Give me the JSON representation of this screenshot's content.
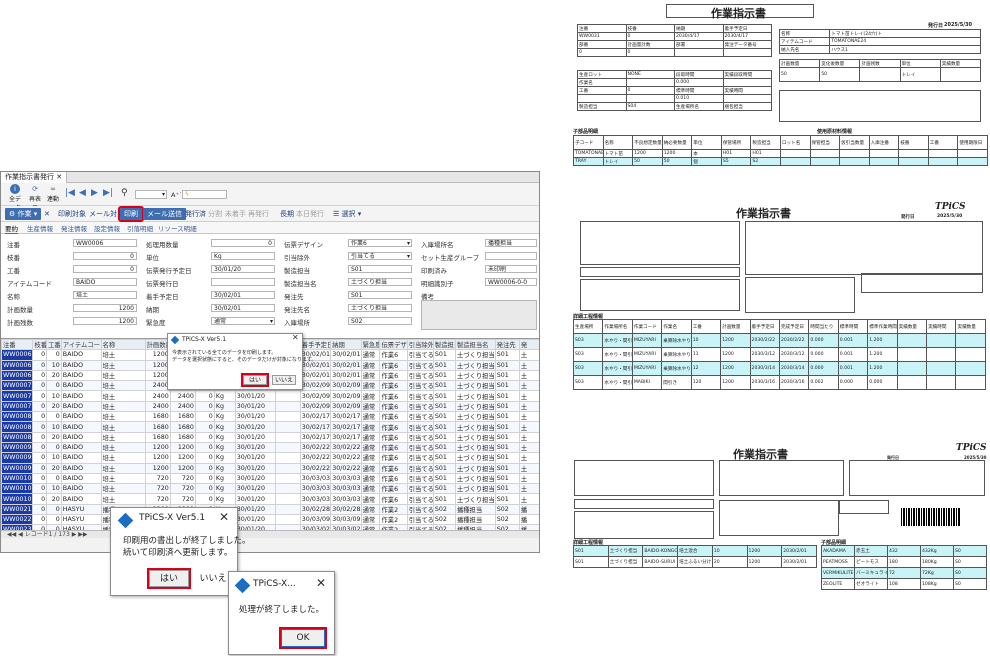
{
  "app": {
    "tab_title": "作業指示書発行",
    "toolbar1": [
      "全データ",
      "再表示",
      "連動"
    ],
    "search_placeholder": "",
    "toolbar2": {
      "work": "作業",
      "print_target": "印刷対象",
      "mail_target": "メール対象",
      "print": "印刷",
      "mail_send": "メール送信",
      "issue_done": "発行済",
      "split": "分割",
      "unstarted": "未着手",
      "reissue": "再発行",
      "long": "長期",
      "today_issue": "本日発行",
      "select": "選択"
    },
    "subtabs": [
      "要約",
      "生産情報",
      "発注情報",
      "設定情報",
      "引落明細",
      "リソース明細"
    ],
    "form": {
      "labels": [
        "注番",
        "枝番",
        "工番",
        "アイテムコード",
        "名称",
        "計画数量",
        "計画残数",
        "処理用数量",
        "単位",
        "伝票発行予定日",
        "伝票発行日",
        "着手予定日",
        "納期",
        "緊急度",
        "伝票デザイン",
        "引当除外",
        "製造担当",
        "製造担当名",
        "発注先",
        "発注先名",
        "入庫場所",
        "入庫場所名",
        "セット生産グループ",
        "印刷済み",
        "明細識別子",
        "備考"
      ],
      "values": {
        "order_no": "WW0006",
        "branch": "0",
        "work_no": "0",
        "item_code": "BAIDO",
        "name": "培土",
        "plan_qty": "1200",
        "plan_rem": "1200",
        "proc_qty": "0",
        "unit": "Kg",
        "issue_plan": "30/01/20",
        "start_plan": "30/02/01",
        "due": "30/02/01",
        "urgency": "通常",
        "design": "作業6",
        "hikiate": "引当てる",
        "mfg": "S01",
        "mfg_name": "土づくり担当",
        "vendor": "S01",
        "vendor_name": "土づくり担当",
        "place": "S02",
        "place_name": "播種担当",
        "printed": "未印刷",
        "detail_id": "WW0006-0-0"
      }
    },
    "grid": {
      "headers": [
        "注番",
        "枝番",
        "工番",
        "アイテムコード",
        "名称",
        "計画数量",
        "計画残数",
        "処理用数量",
        "単位",
        "伝票発行予定日",
        "伝票発行日",
        "着手予定日",
        "納期",
        "緊急度",
        "伝票デザイン",
        "引当除外",
        "製造担当",
        "製造担当名",
        "発注先",
        "発"
      ],
      "rows": [
        [
          "WW0006",
          "0",
          "0",
          "BAIDO",
          "培土",
          "1200",
          "1200",
          "0",
          "Kg",
          "30/01/20",
          "",
          "30/02/01",
          "30/02/01",
          "通常",
          "作業6",
          "引当てる",
          "S01",
          "土づくり担当",
          "S01",
          "土"
        ],
        [
          "WW0006",
          "0",
          "10",
          "BAIDO",
          "培土",
          "1200",
          "1200",
          "0",
          "Kg",
          "30/01/20",
          "",
          "30/02/01",
          "30/02/01",
          "通常",
          "作業6",
          "引当てる",
          "S01",
          "土づくり担当",
          "S01",
          "土"
        ],
        [
          "WW0006",
          "0",
          "20",
          "BAIDO",
          "培土",
          "1200",
          "1200",
          "0",
          "Kg",
          "30/01/20",
          "",
          "30/02/01",
          "30/02/01",
          "通常",
          "作業6",
          "引当てる",
          "S01",
          "土づくり担当",
          "S01",
          "土"
        ],
        [
          "WW0007",
          "0",
          "0",
          "BAIDO",
          "培土",
          "2400",
          "2400",
          "0",
          "Kg",
          "30/01/20",
          "",
          "30/02/09",
          "30/02/09",
          "通常",
          "作業6",
          "引当てる",
          "S01",
          "土づくり担当",
          "S01",
          "土"
        ],
        [
          "WW0007",
          "0",
          "10",
          "BAIDO",
          "培土",
          "2400",
          "2400",
          "0",
          "Kg",
          "30/01/20",
          "",
          "30/02/09",
          "30/02/09",
          "通常",
          "作業6",
          "引当てる",
          "S01",
          "土づくり担当",
          "S01",
          "土"
        ],
        [
          "WW0007",
          "0",
          "20",
          "BAIDO",
          "培土",
          "2400",
          "2400",
          "0",
          "Kg",
          "30/01/20",
          "",
          "30/02/09",
          "30/02/09",
          "通常",
          "作業6",
          "引当てる",
          "S01",
          "土づくり担当",
          "S01",
          "土"
        ],
        [
          "WW0008",
          "0",
          "0",
          "BAIDO",
          "培土",
          "1680",
          "1680",
          "0",
          "Kg",
          "30/01/20",
          "",
          "30/02/17",
          "30/02/17",
          "通常",
          "作業6",
          "引当てる",
          "S01",
          "土づくり担当",
          "S01",
          "土"
        ],
        [
          "WW0008",
          "0",
          "10",
          "BAIDO",
          "培土",
          "1680",
          "1680",
          "0",
          "Kg",
          "30/01/20",
          "",
          "30/02/17",
          "30/02/17",
          "通常",
          "作業6",
          "引当てる",
          "S01",
          "土づくり担当",
          "S01",
          "土"
        ],
        [
          "WW0008",
          "0",
          "20",
          "BAIDO",
          "培土",
          "1680",
          "1680",
          "0",
          "Kg",
          "30/01/20",
          "",
          "30/02/17",
          "30/02/17",
          "通常",
          "作業6",
          "引当てる",
          "S01",
          "土づくり担当",
          "S01",
          "土"
        ],
        [
          "WW0009",
          "0",
          "0",
          "BAIDO",
          "培土",
          "1200",
          "1200",
          "0",
          "Kg",
          "30/01/20",
          "",
          "30/02/22",
          "30/02/22",
          "通常",
          "作業6",
          "引当てる",
          "S01",
          "土づくり担当",
          "S01",
          "土"
        ],
        [
          "WW0009",
          "0",
          "10",
          "BAIDO",
          "培土",
          "1200",
          "1200",
          "0",
          "Kg",
          "30/01/20",
          "",
          "30/02/22",
          "30/02/22",
          "通常",
          "作業6",
          "引当てる",
          "S01",
          "土づくり担当",
          "S01",
          "土"
        ],
        [
          "WW0009",
          "0",
          "20",
          "BAIDO",
          "培土",
          "1200",
          "1200",
          "0",
          "Kg",
          "30/01/20",
          "",
          "30/02/22",
          "30/02/22",
          "通常",
          "作業6",
          "引当てる",
          "S01",
          "土づくり担当",
          "S01",
          "土"
        ],
        [
          "WW0010",
          "0",
          "0",
          "BAIDO",
          "培土",
          "720",
          "720",
          "0",
          "Kg",
          "30/01/20",
          "",
          "30/03/03",
          "30/03/03",
          "通常",
          "作業6",
          "引当てる",
          "S01",
          "土づくり担当",
          "S01",
          "土"
        ],
        [
          "WW0010",
          "0",
          "10",
          "BAIDO",
          "培土",
          "720",
          "720",
          "0",
          "Kg",
          "30/01/20",
          "",
          "30/03/03",
          "30/03/03",
          "通常",
          "作業6",
          "引当てる",
          "S01",
          "土づくり担当",
          "S01",
          "土"
        ],
        [
          "WW0010",
          "0",
          "20",
          "BAIDO",
          "培土",
          "720",
          "720",
          "0",
          "Kg",
          "30/01/20",
          "",
          "30/03/03",
          "30/03/03",
          "通常",
          "作業6",
          "引当てる",
          "S01",
          "土づくり担当",
          "S01",
          "土"
        ],
        [
          "WW0021",
          "0",
          "0",
          "HASYU",
          "播種",
          "1200",
          "1200",
          "0",
          "Kg",
          "30/01/20",
          "",
          "30/02/28",
          "30/02/28",
          "通常",
          "作業2",
          "引当てる",
          "S02",
          "播種担当",
          "S02",
          "播"
        ],
        [
          "WW0022",
          "0",
          "0",
          "HASYU",
          "播種",
          "1200",
          "1200",
          "0",
          "Kg",
          "30/01/20",
          "",
          "30/03/09",
          "30/03/09",
          "通常",
          "作業2",
          "引当てる",
          "S02",
          "播種担当",
          "S02",
          "播"
        ],
        [
          "WW0023",
          "0",
          "0",
          "HASYU",
          "播種",
          "1200",
          "1200",
          "0",
          "Kg",
          "30/01/20",
          "",
          "30/03/02",
          "30/03/02",
          "通常",
          "作業2",
          "引当てる",
          "S02",
          "播種担当",
          "S02",
          "播"
        ]
      ],
      "status": "レコード1 / 173"
    }
  },
  "dialog_confirm": {
    "title": "TPiCS-X Ver5.1",
    "message1": "今表示されている全てのデータを印刷します。",
    "message2": "データを選択状態にすると、そのデータだけが対象になります。",
    "yes": "はい",
    "no": "いいえ"
  },
  "dialog_print": {
    "title": "TPiCS-X Ver5.1",
    "message1": "印刷用の書出しが終了しました。",
    "message2": "続いて印刷済へ更新します。",
    "yes": "はい",
    "no": "いいえ"
  },
  "dialog_done": {
    "title": "TPiCS-X...",
    "message": "処理が終了しました。",
    "ok": "OK"
  },
  "doc1": {
    "title": "作業指示書",
    "issue_label": "発行日",
    "issue_date": "2025/5/30",
    "h1": [
      "注番",
      "枝番",
      "納期",
      "着手予定日"
    ],
    "v1": [
      "WW0031",
      "0",
      "2030/4/17",
      "2030/4/17"
    ],
    "h2": [
      "部番",
      "計画量計数",
      "部署",
      "発注データ番号"
    ],
    "r_name_l": "名称",
    "r_name_v": "トマト苗トレイ(24穴)ト",
    "r_item_l": "アイテムコード",
    "r_item_v": "TOMATONAE24",
    "r_place_l": "納入先名",
    "r_place_v": "ハウス1",
    "plan_h": [
      "計画数量",
      "変化後数量",
      "計画残数",
      "単位",
      "実績数量"
    ],
    "plan_v": [
      "50",
      "50",
      "",
      "トレイ",
      ""
    ],
    "lot_l": "生産ロット",
    "lot_v": "NONE",
    "sec_parts": "子部品明細",
    "sec_use": "使用原材料情報",
    "parts_h": [
      "子コード",
      "名称",
      "不良想定数量",
      "納必要数量",
      "単位",
      "保管場所",
      "製造担当",
      "ロット名",
      "保管担当",
      "仮引当数量",
      "入庫注番",
      "枝番",
      "工番",
      "使用期限日"
    ],
    "parts": [
      [
        "TOMATONAE",
        "トマト苗",
        "1200",
        "1200",
        "本",
        "H01",
        "H01"
      ],
      [
        "TRAY",
        "トレイ",
        "50",
        "50",
        "個",
        "S5",
        "S2"
      ]
    ],
    "mfg_l": "製造担当",
    "mfg_v": "S04",
    "mfg_name": "生産場所名",
    "mfg_name_v": "梱包担当"
  },
  "doc2": {
    "title": "作業指示書",
    "brand": "TPiCS",
    "issue_label": "発行日",
    "issue_date": "2025/5/30",
    "sec": "詳細工程情報",
    "h": [
      "生産場所",
      "作業場所名",
      "作業コード",
      "作業名",
      "工番",
      "計画数量",
      "着手予定日",
      "完成予定日",
      "時間当たり",
      "標準時間",
      "標準作業時間",
      "実績数量",
      "実績時間",
      "実績数量"
    ],
    "rows": [
      [
        "S03",
        "水やり・間引き",
        "MIZUYARI",
        "乗算除水やり(2日おき)",
        "10",
        "1200",
        "2030/2/22",
        "2030/2/22",
        "0.000",
        "0.001",
        "1.200",
        "",
        "",
        ""
      ],
      [
        "S03",
        "水やり・間引き",
        "MIZUYARI",
        "乗算除水やり(2日おき)",
        "11",
        "1200",
        "2030/3/12",
        "2030/3/12",
        "0.000",
        "0.001",
        "1.200",
        "",
        "",
        ""
      ],
      [
        "S03",
        "水やり・間引き",
        "MIZUYARI",
        "乗算除水やり(2日おき)",
        "12",
        "1200",
        "2030/3/14",
        "2030/3/14",
        "0.000",
        "0.001",
        "1.200",
        "",
        "",
        ""
      ],
      [
        "S03",
        "水やり・間引き",
        "MABIKI",
        "間引き",
        "120",
        "1200",
        "2030/3/16",
        "2030/3/16",
        "0.002",
        "0.000",
        "0.000",
        "",
        "",
        ""
      ]
    ]
  },
  "doc3": {
    "title": "作業指示書",
    "brand": "TPiCS",
    "issue_label": "発行日",
    "issue_date": "2025/5/30",
    "sec1": "詳細工程情報",
    "sec2": "子部品明細",
    "rows1": [
      [
        "S01",
        "土づくり担当",
        "BAIDO-KONGOU",
        "培土混合",
        "10",
        "1200",
        "2030/2/01"
      ],
      [
        "S01",
        "土づくり担当",
        "BAIDO-SURUI",
        "培土ふるい分け",
        "20",
        "1200",
        "2030/2/01"
      ]
    ],
    "rows2": [
      [
        "AKADAMA",
        "赤玉土",
        "432",
        "432Kg",
        "S0"
      ],
      [
        "PEATMOSS",
        "ピートモス",
        "180",
        "180Kg",
        "S0"
      ],
      [
        "VERMIKULITE",
        "バーミキュライト",
        "72",
        "72Kg",
        "S0"
      ],
      [
        "ZEOLITE",
        "ゼオライト",
        "108",
        "108Kg",
        "S0"
      ]
    ]
  }
}
